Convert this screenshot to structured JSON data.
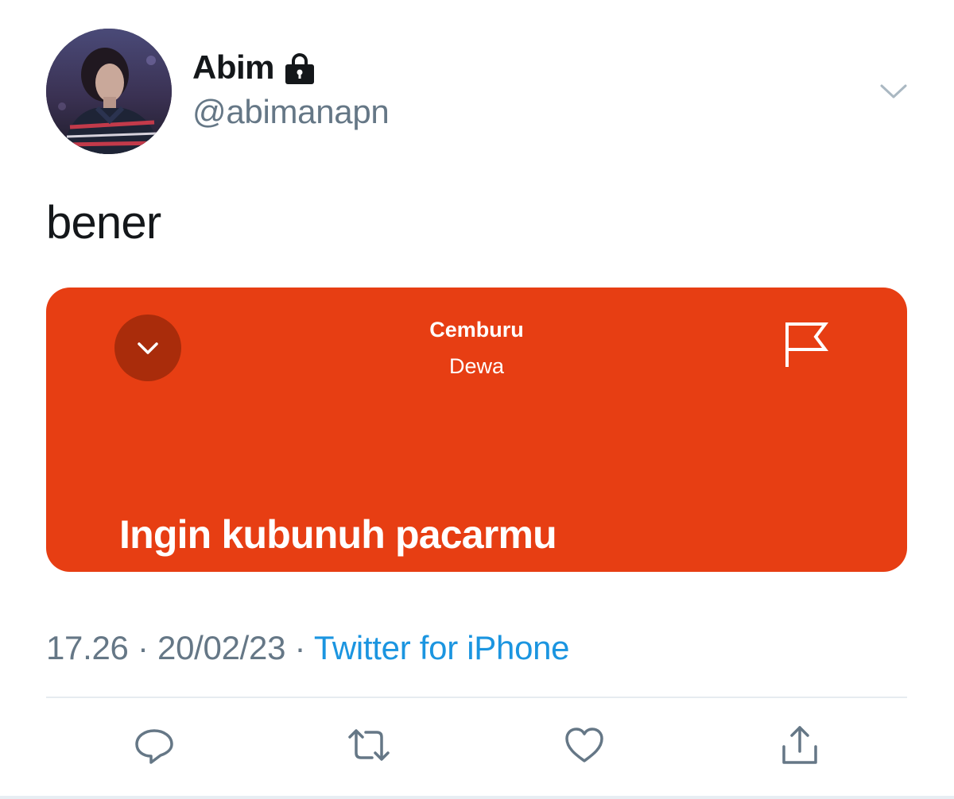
{
  "tweet": {
    "author": {
      "display_name": "Abim",
      "handle": "@abimanapn",
      "protected": true
    },
    "text": "bener",
    "lyrics_card": {
      "song_title": "Cemburu",
      "artist": "Dewa",
      "lyric": "Ingin kubunuh pacarmu",
      "background_color": "#e73e13"
    },
    "time": "17.26",
    "separator": "·",
    "date": "20/02/23",
    "source": "Twitter for iPhone"
  },
  "actions": {
    "icons": [
      "reply-icon",
      "retweet-icon",
      "like-icon",
      "share-icon"
    ]
  },
  "colors": {
    "text_primary": "#14171a",
    "text_secondary": "#657786",
    "link": "#1b95e0"
  }
}
